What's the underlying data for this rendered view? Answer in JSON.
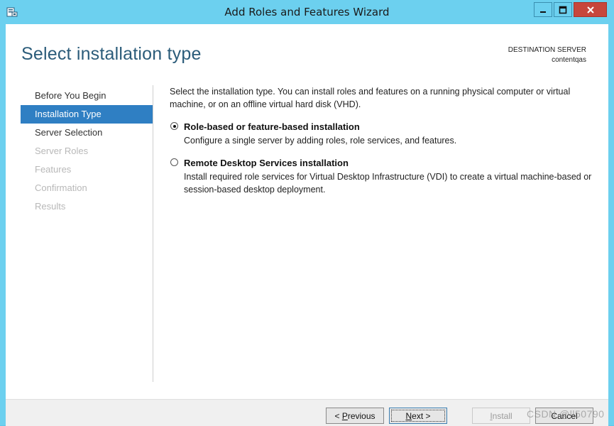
{
  "window": {
    "title": "Add Roles and Features Wizard",
    "icons": {
      "app": "server-manager-icon",
      "minimize": "minimize-icon",
      "maximize": "maximize-icon",
      "close": "close-icon"
    }
  },
  "page": {
    "title": "Select installation type",
    "destination_label": "DESTINATION SERVER",
    "destination_server": "contentqas"
  },
  "nav": {
    "items": [
      {
        "label": "Before You Begin",
        "state": "normal"
      },
      {
        "label": "Installation Type",
        "state": "active"
      },
      {
        "label": "Server Selection",
        "state": "normal"
      },
      {
        "label": "Server Roles",
        "state": "disabled"
      },
      {
        "label": "Features",
        "state": "disabled"
      },
      {
        "label": "Confirmation",
        "state": "disabled"
      },
      {
        "label": "Results",
        "state": "disabled"
      }
    ]
  },
  "main": {
    "intro": "Select the installation type. You can install roles and features on a running physical computer or virtual machine, or on an offline virtual hard disk (VHD).",
    "options": [
      {
        "title": "Role-based or feature-based installation",
        "description": "Configure a single server by adding roles, role services, and features.",
        "checked": true
      },
      {
        "title": "Remote Desktop Services installation",
        "description": "Install required role services for Virtual Desktop Infrastructure (VDI) to create a virtual machine-based or session-based desktop deployment.",
        "checked": false
      }
    ]
  },
  "footer": {
    "previous_prefix": "< ",
    "previous_key": "P",
    "previous_rest": "revious",
    "next_key": "N",
    "next_rest": "ext >",
    "install_key": "I",
    "install_rest": "nstall",
    "cancel": "Cancel"
  },
  "watermark": "CSDN @ll50790",
  "colors": {
    "titlebar": "#6cd0ef",
    "accent": "#2f7fc3",
    "title_text": "#2b5c7a",
    "close": "#c7463c"
  }
}
